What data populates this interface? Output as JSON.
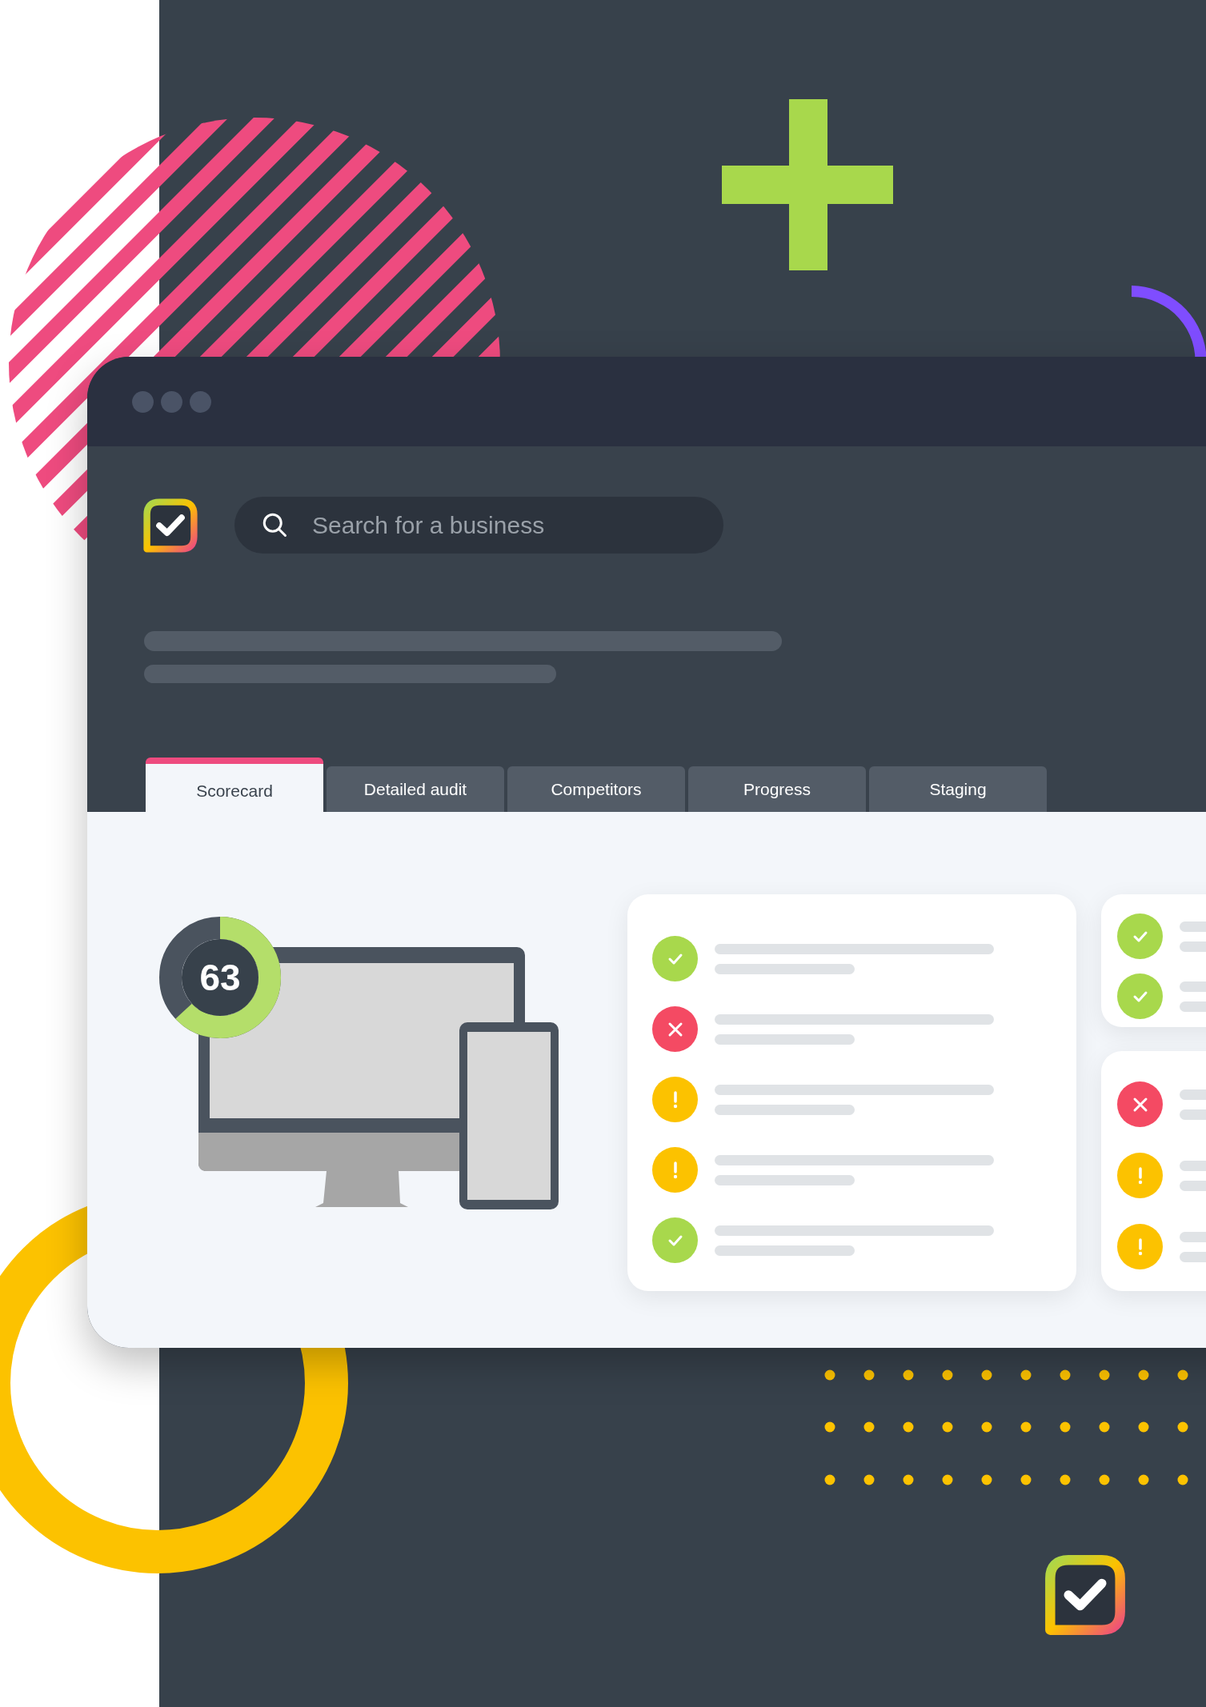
{
  "search": {
    "placeholder": "Search for a business"
  },
  "tabs": [
    {
      "label": "Scorecard",
      "selected": true
    },
    {
      "label": "Detailed audit",
      "selected": false
    },
    {
      "label": "Competitors",
      "selected": false
    },
    {
      "label": "Progress",
      "selected": false
    },
    {
      "label": "Staging",
      "selected": false
    }
  ],
  "score": {
    "value": "63",
    "level": 0.63
  },
  "check_cards": [
    {
      "items": [
        {
          "kind": "pass"
        },
        {
          "kind": "fail"
        },
        {
          "kind": "warning"
        },
        {
          "kind": "warning"
        },
        {
          "kind": "pass"
        }
      ]
    },
    {
      "items": [
        {
          "kind": "pass"
        },
        {
          "kind": "pass"
        }
      ]
    },
    {
      "items": [
        {
          "kind": "fail"
        },
        {
          "kind": "warning"
        },
        {
          "kind": "warning"
        }
      ]
    }
  ]
}
